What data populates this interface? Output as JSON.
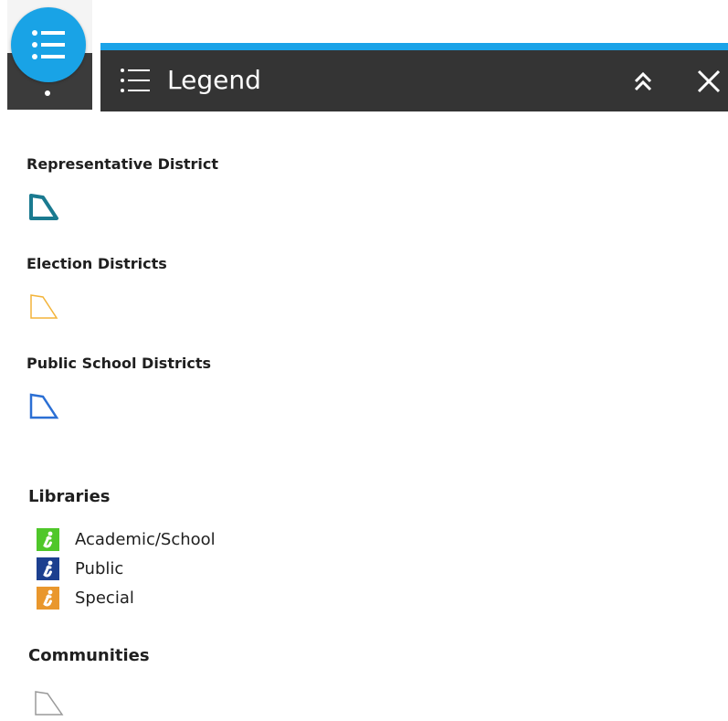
{
  "header": {
    "title": "Legend"
  },
  "layers": {
    "representative_district": {
      "title": "Representative District",
      "color": "#1a7a90"
    },
    "election_districts": {
      "title": "Election Districts",
      "color": "#f3b43a"
    },
    "public_school_districts": {
      "title": "Public School Districts",
      "color": "#2b6fd4"
    },
    "libraries": {
      "title": "Libraries",
      "items": [
        {
          "label": "Academic/School",
          "color": "#4fc72a"
        },
        {
          "label": "Public",
          "color": "#1c3f8f"
        },
        {
          "label": "Special",
          "color": "#e9972d"
        }
      ]
    },
    "communities": {
      "title": "Communities",
      "color": "#9a9a9a"
    }
  },
  "icons": {
    "legend": "list-icon",
    "collapse": "double-chevron-up-icon",
    "close": "close-icon",
    "library": "info-icon"
  },
  "colors": {
    "accent": "#1aa3e8",
    "header_bg": "#343434"
  }
}
